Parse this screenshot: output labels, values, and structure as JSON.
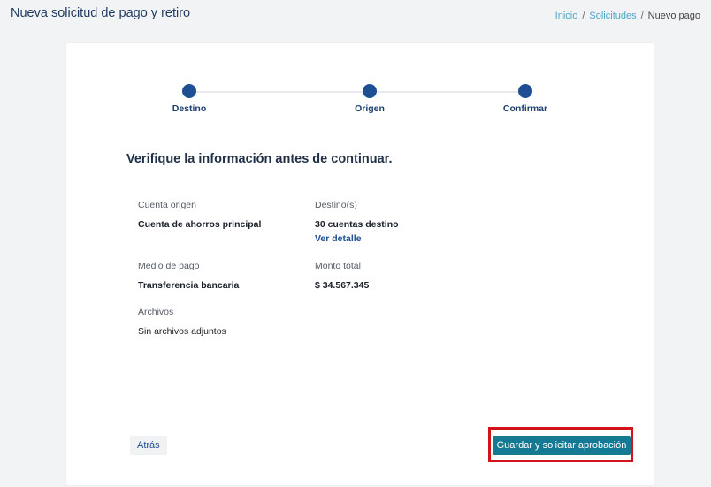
{
  "header": {
    "title": "Nueva solicitud de pago y retiro",
    "breadcrumb": {
      "items": [
        {
          "label": "Inicio"
        },
        {
          "label": "Solicitudes"
        }
      ],
      "current": "Nuevo pago",
      "separator": "/"
    }
  },
  "stepper": {
    "steps": [
      {
        "label": "Destino"
      },
      {
        "label": "Origen"
      },
      {
        "label": "Confirmar"
      }
    ],
    "active_color": "#1e4f92"
  },
  "summary": {
    "heading": "Verifique la información antes de continuar.",
    "cuenta_origen": {
      "label": "Cuenta origen",
      "value": "Cuenta de ahorros principal"
    },
    "destinos": {
      "label": "Destino(s)",
      "value": "30 cuentas destino",
      "link": "Ver detalle"
    },
    "medio_pago": {
      "label": "Medio de pago",
      "value": "Transferencia bancaria"
    },
    "monto_total": {
      "label": "Monto total",
      "value": "$ 34.567.345"
    },
    "archivos": {
      "label": "Archivos",
      "value": "Sin archivos adjuntos"
    }
  },
  "actions": {
    "back_label": "Atrás",
    "submit_label": "Guardar y solicitar aprobación",
    "submit_color": "#147a94",
    "highlight_color": "#d4121a"
  }
}
